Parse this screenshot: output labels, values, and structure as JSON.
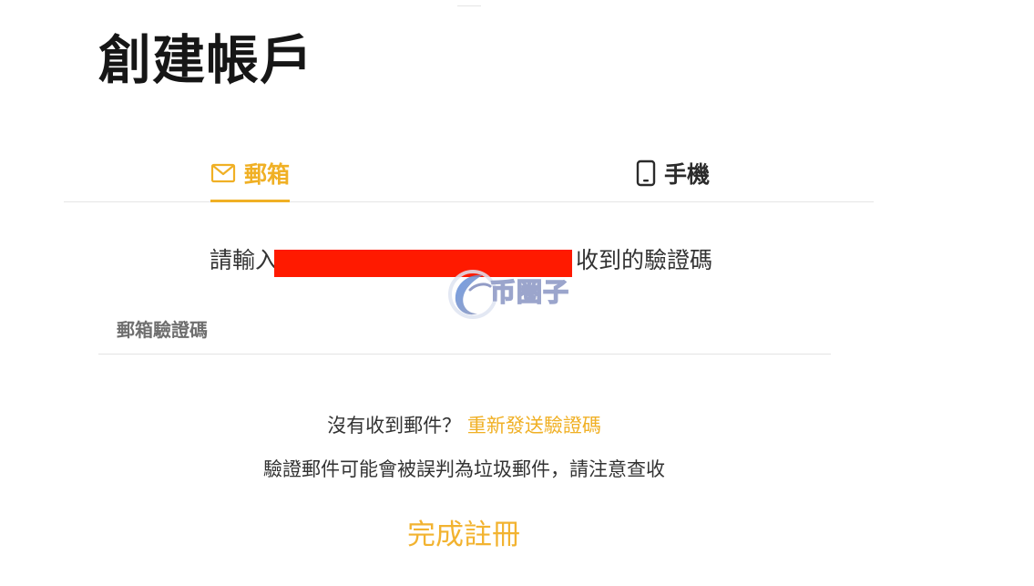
{
  "page": {
    "title": "創建帳戶"
  },
  "tabs": [
    {
      "label": "郵箱",
      "icon": "mail-icon",
      "active": true
    },
    {
      "label": "手機",
      "icon": "phone-icon",
      "active": false
    }
  ],
  "instruction": {
    "prefix": "請輸入",
    "suffix": "收到的驗證碼"
  },
  "watermark": {
    "text": "币圈子"
  },
  "code_field": {
    "placeholder": "郵箱驗證碼",
    "value": ""
  },
  "resend": {
    "question": "沒有收到郵件？",
    "link_label": "重新發送驗證碼"
  },
  "spam_note": "驗證郵件可能會被誤判為垃圾郵件，請注意查收",
  "submit": {
    "label": "完成註冊"
  },
  "colors": {
    "accent": "#f0b025",
    "redaction": "#ff1a00",
    "divider": "#e6e6e6",
    "text": "#333333"
  }
}
